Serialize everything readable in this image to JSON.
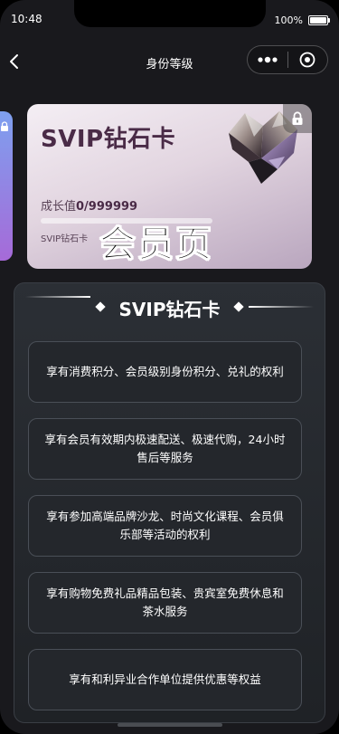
{
  "status_bar": {
    "time": "10:48",
    "battery_text": "100%"
  },
  "nav": {
    "title": "身份等级",
    "back_icon": "chevron-left-icon",
    "more_icon": "more-dots-icon",
    "close_icon": "target-circle-icon"
  },
  "card": {
    "title": "SVIP钻石卡",
    "growth_label": "成长值",
    "growth_value": "0/999999",
    "progress": 0,
    "level_name": "SVIP钻石卡",
    "colors": {
      "title": "#4a2b47",
      "gradient_start": "#f4eef4",
      "gradient_end": "#b9a6be"
    }
  },
  "watermark": "会员页",
  "panel": {
    "title": "SVIP钻石卡",
    "benefits": [
      "享有消费积分、会员级别身份积分、兑礼的权利",
      "享有会员有效期内极速配送、极速代购，24小时售后等服务",
      "享有参加高端品牌沙龙、时尚文化课程、会员俱乐部等活动的权利",
      "享有购物免费礼品精品包装、贵宾室免费休息和茶水服务",
      "享有和利异业合作单位提供优惠等权益"
    ]
  }
}
